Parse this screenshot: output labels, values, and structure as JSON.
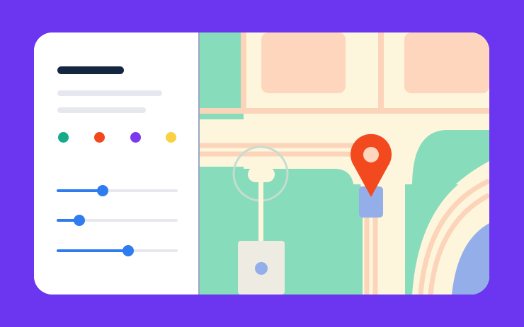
{
  "colors": {
    "background": "#6c35f0",
    "card": "#ffffff",
    "divider": "#9aa7c4",
    "title_bar": "#142640",
    "placeholder_bar": "#e6e8ee",
    "slider_track": "#e6e8ee",
    "slider_fill": "#2f7bf0",
    "map_green": "#86dcbb",
    "map_road_cream": "#fdf6dc",
    "map_road_stripe": "#fcd4ba",
    "map_block_peach": "#fdd6bd",
    "map_building": "#eeece2",
    "map_accent_blue": "#93aee9",
    "map_ring": "#c5ddd0",
    "pin": "#f24a1e"
  },
  "sidebar": {
    "color_options": [
      {
        "name": "teal",
        "color": "#15aa8a"
      },
      {
        "name": "orange-red",
        "color": "#f2481d"
      },
      {
        "name": "purple",
        "color": "#7a39ed"
      },
      {
        "name": "yellow",
        "color": "#fad241"
      }
    ],
    "sliders": [
      {
        "name": "slider-1",
        "value": 0.38
      },
      {
        "name": "slider-2",
        "value": 0.19
      },
      {
        "name": "slider-3",
        "value": 0.59
      }
    ]
  },
  "map": {
    "icons": {
      "pin": "location-pin-icon",
      "user_location": "user-location-icon"
    }
  }
}
